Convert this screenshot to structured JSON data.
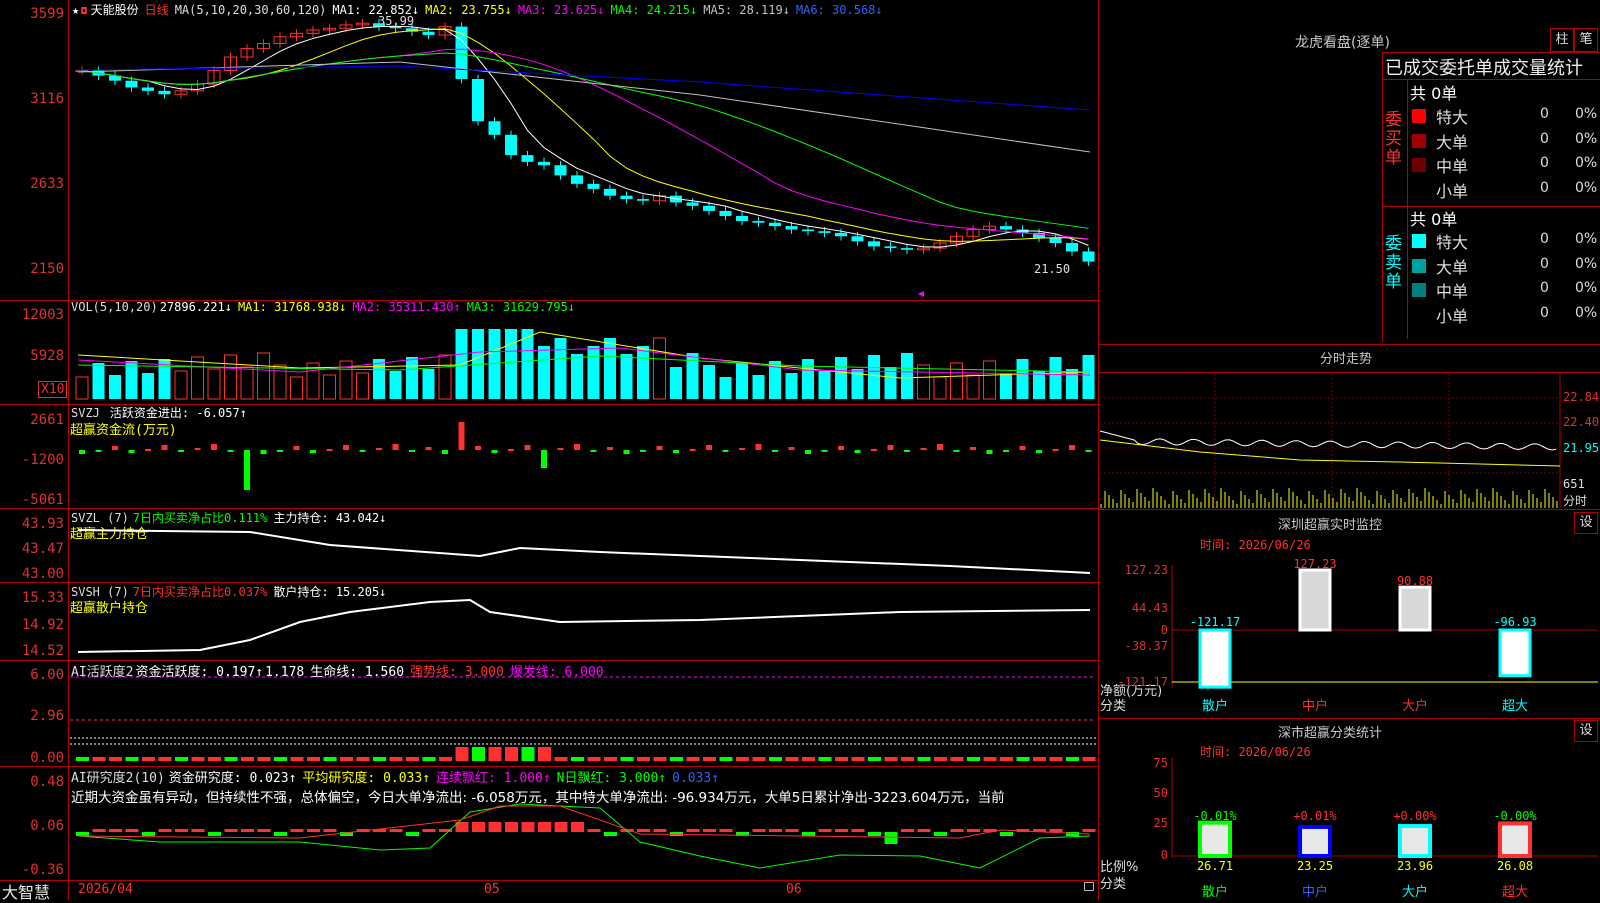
{
  "main_chart": {
    "star": "★",
    "stock_name": "天能股份",
    "period": "日线",
    "ma_label": "MA(5,10,20,30,60,120)",
    "ma1": "MA1: 22.852↓",
    "ma2": "MA2: 23.755↓",
    "ma3": "MA3: 23.625↓",
    "ma4": "MA4: 24.215↓",
    "ma5": "MA5: 28.119↓",
    "ma6": "MA6: 30.568↓",
    "high_mark": "35.99",
    "low_mark": "21.50",
    "y_labels": [
      "3599",
      "3116",
      "2633",
      "2150"
    ]
  },
  "vol_panel": {
    "label": "VOL(5,10,20)",
    "value": "27896.221↓",
    "ma1": "MA1: 31768.938↓",
    "ma2": "MA2: 35311.430↑",
    "ma3": "MA3: 31629.795↓",
    "y_labels": [
      "12003",
      "5928"
    ],
    "unit": "X10"
  },
  "svzj_panel": {
    "label": "SVZJ",
    "text": "活跃资金进出: -6.057↑",
    "sub": "超赢资金流(万元)",
    "y_labels": [
      "2661",
      "-1200",
      "-5061"
    ]
  },
  "svzl_panel": {
    "label": "SVZL (7)",
    "ratio": "7日内买卖净占比0.111%",
    "hold": "主力持仓: 43.042↓",
    "sub": "超赢主力持仓",
    "y_labels": [
      "43.93",
      "43.47",
      "43.00"
    ]
  },
  "svsh_panel": {
    "label": "SVSH (7)",
    "ratio": "7日内买卖净占比0.037%",
    "hold": "散户持仓: 15.205↓",
    "sub": "超赢散户持仓",
    "y_labels": [
      "15.33",
      "14.92",
      "14.52"
    ]
  },
  "ai_active_panel": {
    "label": "AI活跃度2",
    "a": "资金活跃度: 0.197↑",
    "b": "1.178",
    "c": "生命线: 1.560",
    "d": "强势线: 3.000",
    "e": "爆发线: 6.000",
    "y_labels": [
      "6.00",
      "2.96",
      "0.00"
    ]
  },
  "ai_research_panel": {
    "label": "AI研究度2(10)",
    "a": "资金研究度: 0.023↑",
    "b": "平均研究度: 0.033↑",
    "c": "连续飘红: 1.000↑",
    "d": "N日飘红: 3.000↑",
    "e": "0.033↑",
    "comment": "近期大资金虽有异动，但持续性不强，总体偏空，今日大单净流出: -6.058万元，其中特大单净流出: -96.934万元，大单5日累计净出-3223.604万元，当前",
    "y_labels": [
      "0.48",
      "0.06",
      "-0.36"
    ]
  },
  "footer": {
    "brand": "大智慧",
    "dates": [
      "2026/04",
      "05",
      "06"
    ]
  },
  "right_panel": {
    "lhb_title": "龙虎看盘(逐单)",
    "btn1": "柱",
    "btn2": "笔",
    "stat_title": "已成交委托单成交量统计",
    "buy_label": "委买单",
    "sell_label": "委卖单",
    "buy_total": "共 0单",
    "sell_total": "共 0单",
    "buy_rows": [
      {
        "name": "特大",
        "count": "0",
        "pct": "0%",
        "color": "#ff0000"
      },
      {
        "name": "大单",
        "count": "0",
        "pct": "0%",
        "color": "#a00000"
      },
      {
        "name": "中单",
        "count": "0",
        "pct": "0%",
        "color": "#700000"
      },
      {
        "name": "小单",
        "count": "0",
        "pct": "0%",
        "color": "#000000"
      }
    ],
    "sell_rows": [
      {
        "name": "特大",
        "count": "0",
        "pct": "0%",
        "color": "#00ffff"
      },
      {
        "name": "大单",
        "count": "0",
        "pct": "0%",
        "color": "#00a0a0"
      },
      {
        "name": "中单",
        "count": "0",
        "pct": "0%",
        "color": "#008080"
      },
      {
        "name": "小单",
        "count": "0",
        "pct": "0%",
        "color": "#000000"
      }
    ],
    "intraday_title": "分时走势",
    "intraday_labels": [
      "22.84",
      "22.40",
      "21.95",
      "651",
      "分时"
    ],
    "sz_monitor_title": "深圳超赢实时监控",
    "sz_set": "设",
    "sz_time": "时间: 2026/06/26",
    "sz_y_labels": [
      "127.23",
      "44.43",
      "0",
      "-38.37",
      "-121.17"
    ],
    "sz_axis_title": "净额(万元)",
    "sz_axis_sub": "分类",
    "sz_categories": [
      "散户",
      "中户",
      "大户",
      "超大"
    ],
    "sz_values": [
      -121.17,
      127.23,
      90.88,
      -96.93
    ],
    "sz_value_labels": [
      "-121.17",
      "127.23",
      "90.88",
      "-96.93"
    ],
    "sm_title": "深市超赢分类统计",
    "sm_set": "设",
    "sm_time": "时间: 2026/06/26",
    "sm_y_labels": [
      "75",
      "50",
      "25",
      "0"
    ],
    "sm_axis_title": "比例%",
    "sm_axis_sub": "分类",
    "sm_categories": [
      "散户",
      "中户",
      "大户",
      "超大"
    ],
    "sm_values": [
      26.71,
      23.25,
      23.96,
      26.08
    ],
    "sm_value_labels": [
      "26.71",
      "23.25",
      "23.96",
      "26.08"
    ],
    "sm_change_labels": [
      "-0.01%",
      "+0.01%",
      "+0.00%",
      "-0.00%"
    ]
  },
  "colors": {
    "up": "#ff3030",
    "down": "#00ffff",
    "grid": "#b00000",
    "ma1": "#ffffff",
    "ma2": "#ffff00",
    "ma3": "#ff00ff",
    "ma4": "#00ff00",
    "ma5": "#c0c0c0",
    "ma6": "#0000ff"
  }
}
